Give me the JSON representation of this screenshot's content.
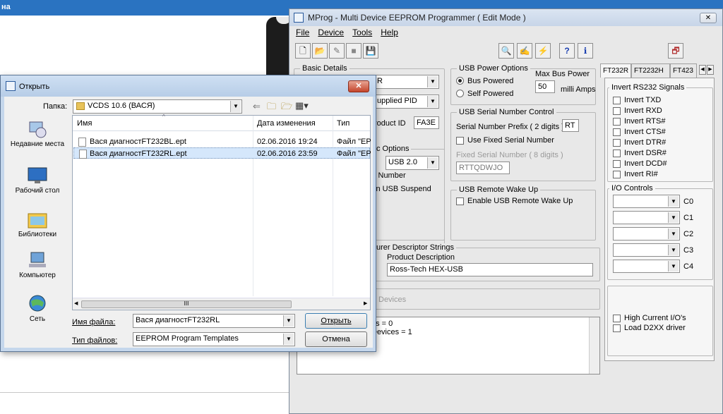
{
  "background_window": {
    "title": "на"
  },
  "mprog": {
    "title": "MProg - Multi Device EEPROM Programmer ( Edit Mode )",
    "close": "✕",
    "menu": [
      "File",
      "Device",
      "Tools",
      "Help"
    ],
    "toolbar_glyphs": {
      "new": "🗋",
      "open": "📂",
      "edit": "✎",
      "stop": "■",
      "save": "💾",
      "search": "🔍",
      "program": "✍",
      "erase": "⚡",
      "help": "?",
      "about": "ℹ",
      "window": "🗗"
    },
    "basic_details": {
      "label": "Basic Details",
      "device_type": "R",
      "pid_type": "upplied PID",
      "product_id_label": "roduct ID",
      "product_id": "FA3E",
      "options_label": "c Options",
      "usb_version": "USB 2.0",
      "serial_number_label": "l Number",
      "usb_suspend_label": "in USB Suspend"
    },
    "usb_power": {
      "label": "USB Power Options",
      "bus_powered": "Bus Powered",
      "self_powered": "Self Powered",
      "max_bus_power_label": "Max Bus Power",
      "max_bus_power_value": "50",
      "milli_amps": "milli Amps"
    },
    "usb_serial": {
      "label": "USB Serial Number Control",
      "prefix_label": "Serial Number Prefix ( 2 digits )",
      "prefix_value": "RT",
      "use_fixed": "Use Fixed Serial Number",
      "fixed_label": "Fixed Serial Number ( 8 digits )",
      "fixed_value": "RTTQDWJO"
    },
    "remote_wake": {
      "label": "USB Remote Wake Up",
      "enable": "Enable USB Remote Wake Up"
    },
    "descriptor": {
      "label": "urer Descriptor Strings",
      "product_description_label": "Product Description",
      "product_description": "Ross-Tech HEX-USB"
    },
    "devices_label": "Devices",
    "log_lines": [
      "es = 0",
      "Devices = 1"
    ],
    "tabs": [
      "FT232R",
      "FT2232H",
      "FT423"
    ],
    "tab_scroll": {
      "left": "◀",
      "right": "▶"
    },
    "invert_rs232": {
      "label": "Invert RS232 Signals",
      "items": [
        "Invert TXD",
        "Invert RXD",
        "Invert RTS#",
        "Invert CTS#",
        "Invert DTR#",
        "Invert DSR#",
        "Invert DCD#",
        "Invert RI#"
      ]
    },
    "io_controls": {
      "label": "I/O Controls",
      "items": [
        "C0",
        "C1",
        "C2",
        "C3",
        "C4"
      ]
    },
    "extras": [
      "High Current I/O's",
      "Load D2XX driver"
    ]
  },
  "open_dialog": {
    "title": "Открыть",
    "close": "✕",
    "folder_label": "Папка:",
    "folder_value": "VCDS 10.6 (ВАСЯ)",
    "nav_glyphs": {
      "back": "⇐",
      "up": "🗀",
      "new_folder": "🗁",
      "view": "▦▾"
    },
    "places": [
      "Недавние места",
      "Рабочий стол",
      "Библиотеки",
      "Компьютер",
      "Сеть"
    ],
    "columns": {
      "name": "Имя",
      "date": "Дата изменения",
      "type": "Тип",
      "sort": "^"
    },
    "files": [
      {
        "name": "Вася диагностFT232BL.ept",
        "date": "02.06.2016 19:24",
        "type": "Файл \"EP"
      },
      {
        "name": "Вася диагностFT232RL.ept",
        "date": "02.06.2016 23:59",
        "type": "Файл \"EP"
      }
    ],
    "hscroll": {
      "left": "◀",
      "thumb": "III",
      "right": "▶"
    },
    "filename_label": "Имя файла:",
    "filename_value": "Вася диагностFT232RL",
    "filetype_label": "Тип файлов:",
    "filetype_value": "EEPROM Program Templates",
    "open_button": "Открыть",
    "cancel_button": "Отмена"
  }
}
